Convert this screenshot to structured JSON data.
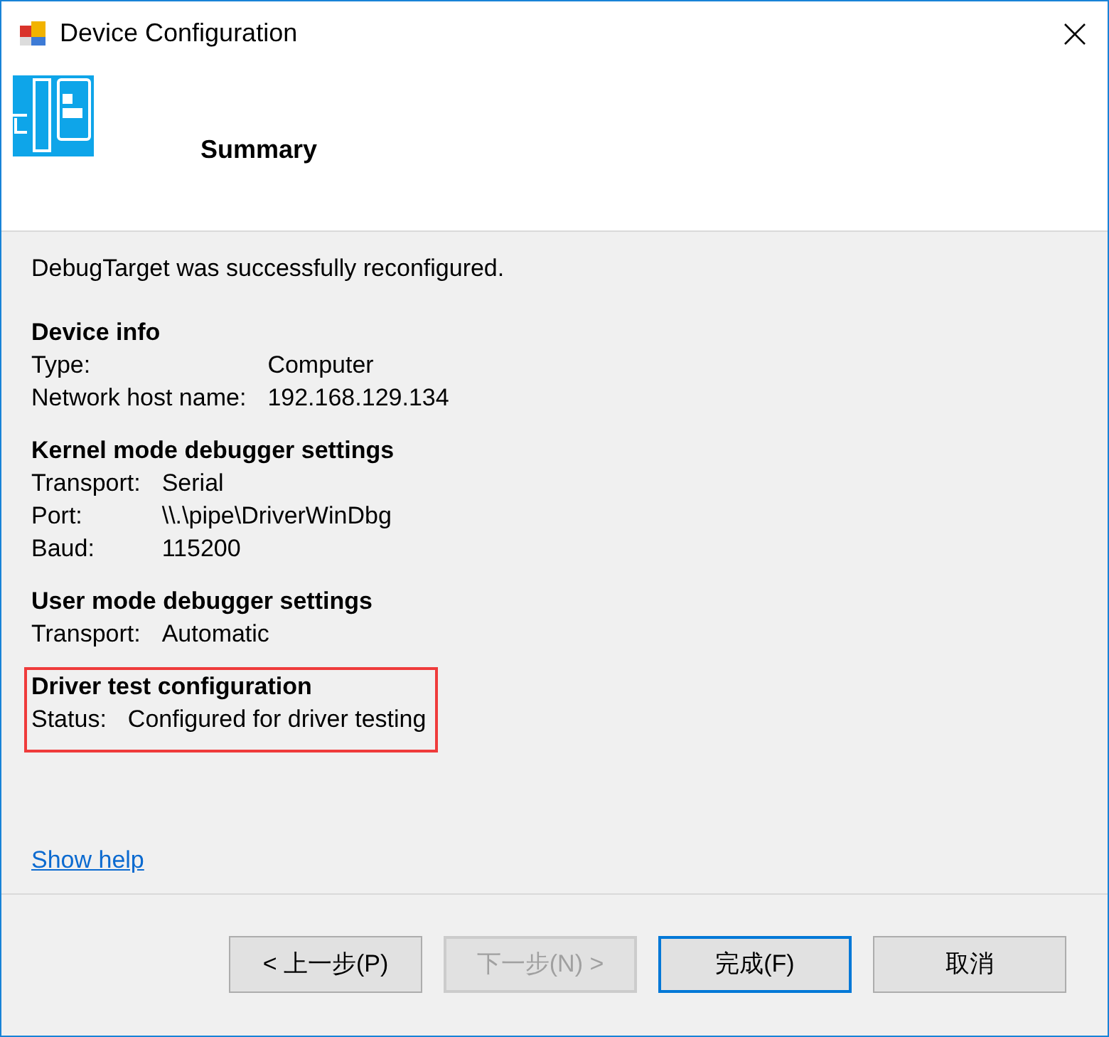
{
  "window": {
    "title": "Device Configuration"
  },
  "header": {
    "title": "Summary"
  },
  "message": "DebugTarget was successfully reconfigured.",
  "sections": [
    {
      "title": "Device info",
      "highlighted": false,
      "rows": [
        {
          "label": "Type:",
          "value": "Computer"
        },
        {
          "label": "Network host name:",
          "value": "192.168.129.134"
        }
      ]
    },
    {
      "title": "Kernel mode debugger settings",
      "highlighted": false,
      "rows": [
        {
          "label": "Transport:",
          "value": "Serial"
        },
        {
          "label": "Port:",
          "value": "\\\\.\\pipe\\DriverWinDbg"
        },
        {
          "label": "Baud:",
          "value": "115200"
        }
      ]
    },
    {
      "title": "User mode debugger settings",
      "highlighted": false,
      "rows": [
        {
          "label": "Transport:",
          "value": "Automatic"
        }
      ]
    },
    {
      "title": "Driver test configuration",
      "highlighted": true,
      "rows": [
        {
          "label": "Status:",
          "value": "Configured for driver testing"
        }
      ]
    }
  ],
  "help_link": "Show help",
  "buttons": [
    {
      "label": "< 上一步(P)",
      "disabled": false,
      "default": false
    },
    {
      "label": "下一步(N) >",
      "disabled": true,
      "default": false
    },
    {
      "label": "完成(F)",
      "disabled": false,
      "default": true
    },
    {
      "label": "取消",
      "disabled": false,
      "default": false
    }
  ]
}
